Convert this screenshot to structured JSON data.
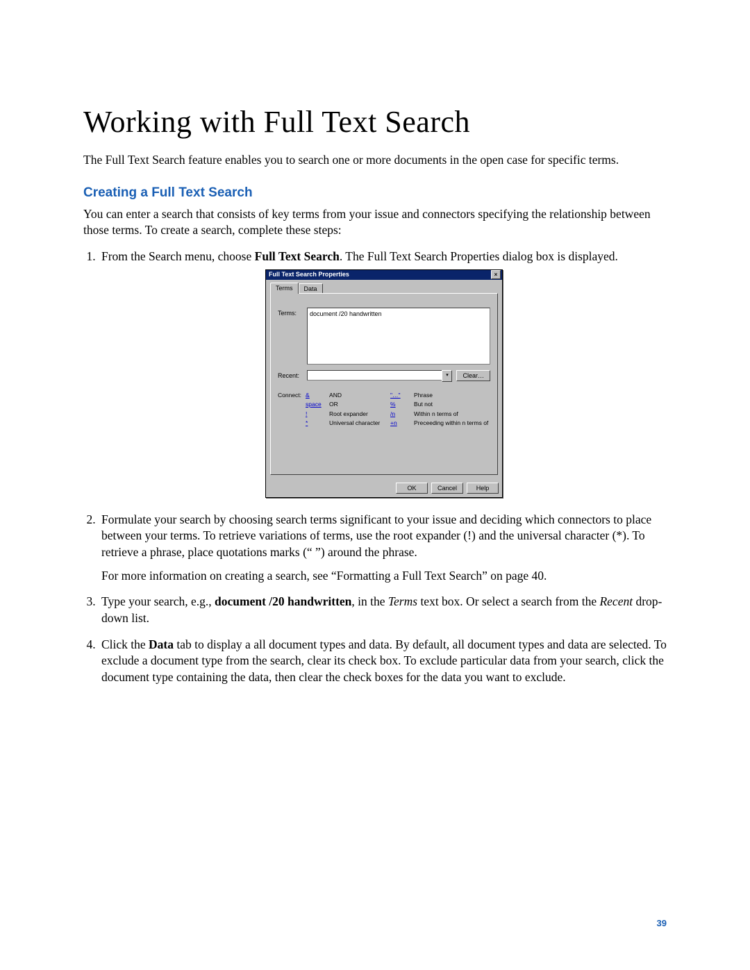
{
  "doc": {
    "title": "Working with Full Text Search",
    "intro": "The Full Text Search feature enables you to search one or more documents in the open case for specific terms.",
    "section_heading": "Creating a Full Text Search",
    "section_intro": "You can enter a search that consists of key terms from your issue and connectors specifying the relationship between those terms. To create a search, complete these steps:",
    "page_number": "39"
  },
  "steps": {
    "s1_pre": "From the Search menu, choose ",
    "s1_bold": "Full Text Search",
    "s1_post": ". The Full Text Search Properties dialog box is displayed.",
    "s2": "Formulate your search by choosing search terms significant to your issue and deciding which connectors to place between your terms. To retrieve variations of terms, use the root expander (!) and the universal character (*). To retrieve a phrase, place quotations marks (“ ”) around the phrase.",
    "s2b": "For more information on creating a search, see “Formatting a Full Text Search” on page 40.",
    "s3_pre": "Type your search, e.g., ",
    "s3_bold": "document /20 handwritten",
    "s3_mid": ", in the ",
    "s3_italic1": "Terms",
    "s3_mid2": " text box. Or select a search from the ",
    "s3_italic2": "Recent",
    "s3_post": " drop-down list.",
    "s4_pre": "Click the ",
    "s4_bold": "Data",
    "s4_post": " tab to display a all document types and data. By default, all document types and data are selected. To exclude a document type from the search, clear its check box. To exclude particular data from your search, click the document type containing the data, then clear the check boxes for the data you want to exclude."
  },
  "dialog": {
    "title": "Full Text Search Properties",
    "close": "×",
    "tabs": {
      "terms": "Terms",
      "data": "Data"
    },
    "labels": {
      "terms": "Terms:",
      "recent": "Recent:",
      "connect": "Connect:"
    },
    "terms_value": "document /20 handwritten",
    "dropdown_arrow": "▾",
    "buttons": {
      "clear": "Clear…",
      "ok": "OK",
      "cancel": "Cancel",
      "help": "Help"
    },
    "connectors": {
      "col1_sym": [
        "&",
        "space",
        "!",
        "*"
      ],
      "col1_desc": [
        "AND",
        "OR",
        "Root expander",
        "Universal character"
      ],
      "col2_sym": [
        "\"…\"",
        "%",
        "/n",
        "+n"
      ],
      "col2_desc": [
        "Phrase",
        "But not",
        "Within n terms of",
        "Preceeding within n terms of"
      ]
    }
  }
}
